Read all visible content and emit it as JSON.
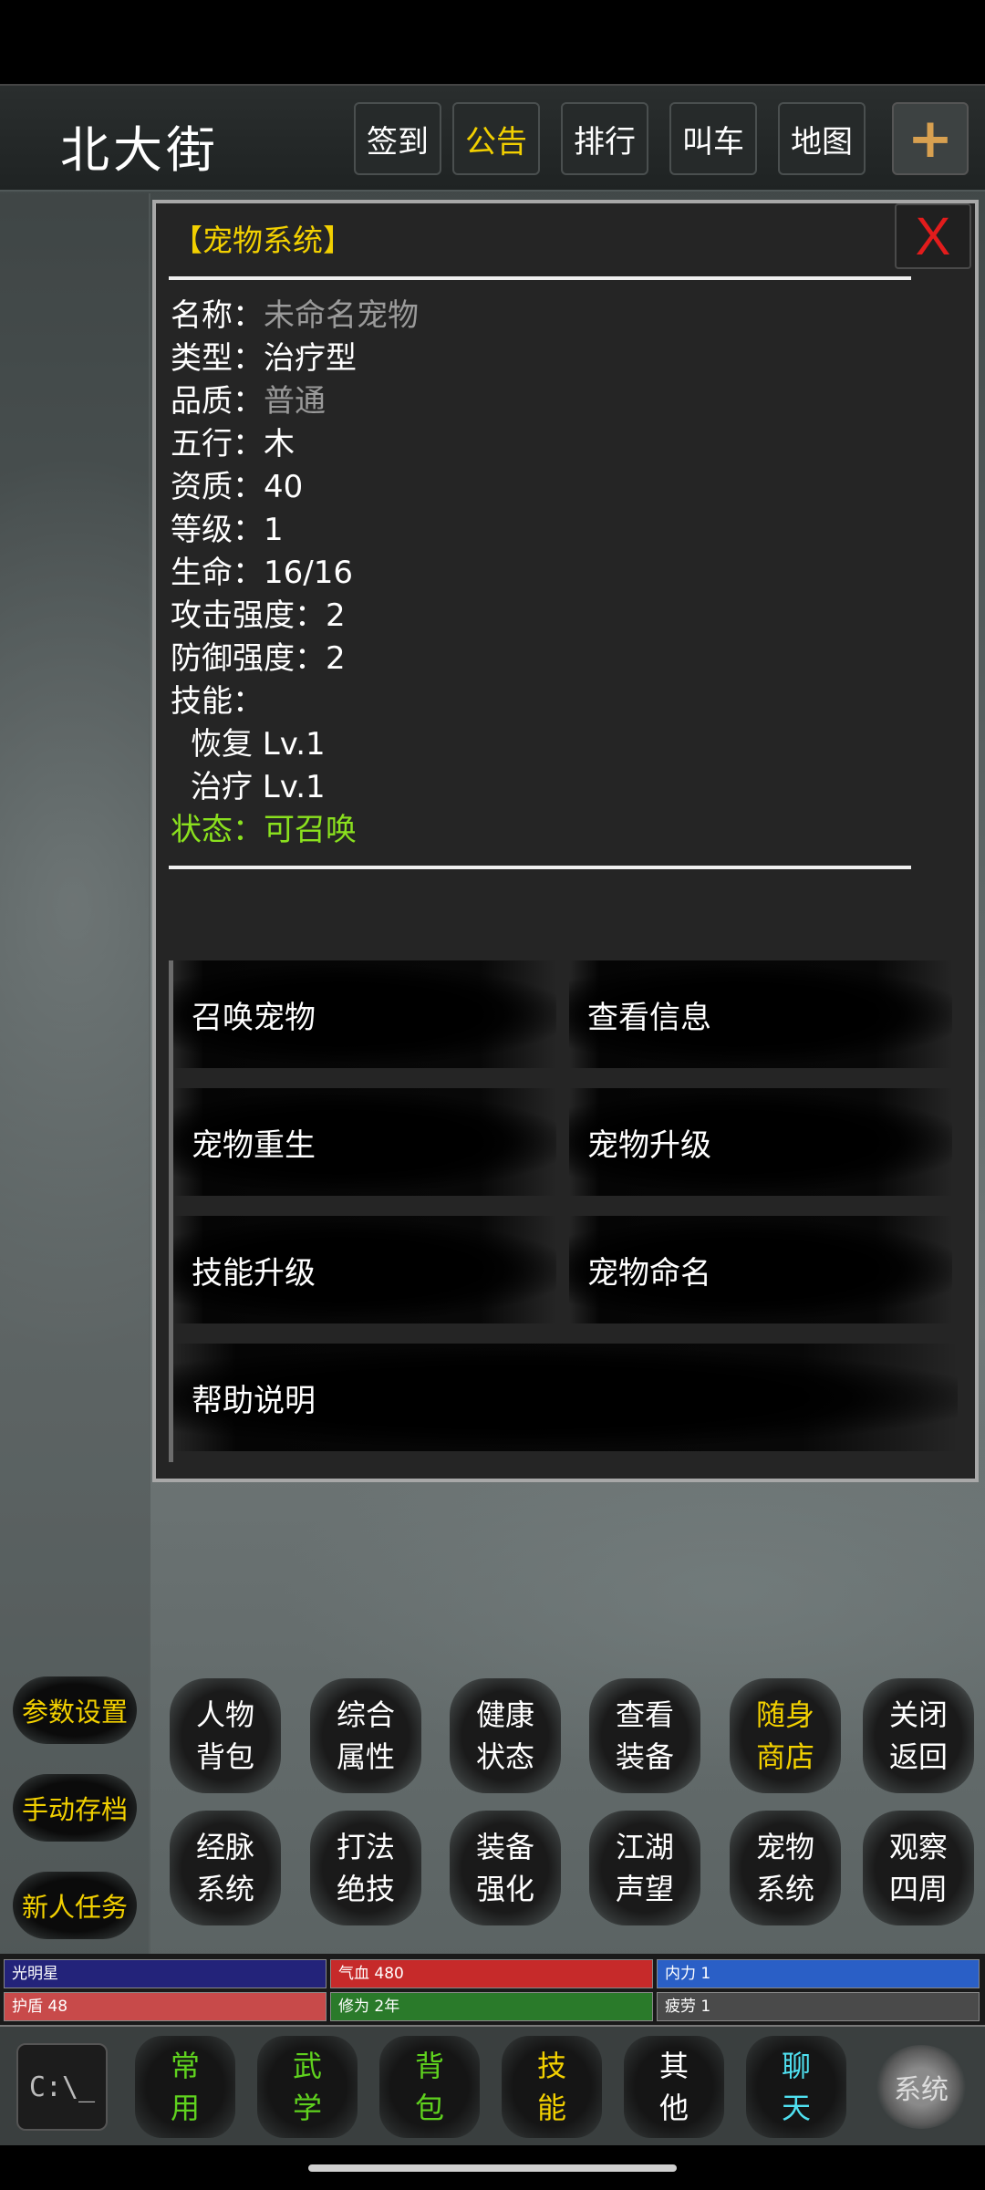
{
  "header": {
    "location": "北大街",
    "buttons": [
      "签到",
      "公告",
      "排行",
      "叫车",
      "地图"
    ],
    "plus": "+"
  },
  "panel": {
    "title": "【宠物系统】",
    "close": "X",
    "fields": [
      {
        "label": "名称：",
        "value": "未命名宠物",
        "gray": true
      },
      {
        "label": "类型：",
        "value": "治疗型"
      },
      {
        "label": "品质：",
        "value": "普通",
        "gray": true
      },
      {
        "label": "五行：",
        "value": "木"
      },
      {
        "label": "资质：",
        "value": "40"
      },
      {
        "label": "等级：",
        "value": "1"
      },
      {
        "label": "生命：",
        "value": "16/16"
      },
      {
        "label": "攻击强度：",
        "value": "2"
      },
      {
        "label": "防御强度：",
        "value": "2"
      },
      {
        "label": "技能：",
        "value": ""
      }
    ],
    "skills": [
      "恢复 Lv.1",
      "治疗 Lv.1"
    ],
    "status": "状态：可召唤",
    "actions": [
      "召唤宠物",
      "查看信息",
      "宠物重生",
      "宠物升级",
      "技能升级",
      "宠物命名",
      "帮助说明"
    ]
  },
  "side_buttons": [
    "参数设置",
    "手动存档",
    "新人任务"
  ],
  "functions": [
    [
      "人物",
      "背包"
    ],
    [
      "综合",
      "属性"
    ],
    [
      "健康",
      "状态"
    ],
    [
      "查看",
      "装备"
    ],
    [
      "随身",
      "商店"
    ],
    [
      "关闭",
      "返回"
    ],
    [
      "经脉",
      "系统"
    ],
    [
      "打法",
      "绝技"
    ],
    [
      "装备",
      "强化"
    ],
    [
      "江湖",
      "声望"
    ],
    [
      "宠物",
      "系统"
    ],
    [
      "观察",
      "四周"
    ]
  ],
  "stats": [
    {
      "text": "光明星",
      "color": "#23237a",
      "fill": 1.0
    },
    {
      "text": "气血 480",
      "color": "#c62a2a",
      "fill": 1.0
    },
    {
      "text": "内力 1",
      "color": "#2a5fc6",
      "fill": 1.0
    },
    {
      "text": "护盾 48",
      "color": "#c84a4a",
      "fill": 1.0
    },
    {
      "text": "修为 2年",
      "color": "#2a7a2a",
      "fill": 1.0
    },
    {
      "text": "疲劳 1",
      "color": "#4a4a4a",
      "fill": 1.0
    }
  ],
  "tabs": [
    {
      "top": "常",
      "bottom": "用",
      "color": "#5fd21e"
    },
    {
      "top": "武",
      "bottom": "学",
      "color": "#5fd21e"
    },
    {
      "top": "背",
      "bottom": "包",
      "color": "#5fd21e"
    },
    {
      "top": "技",
      "bottom": "能",
      "color": "#f2d000"
    },
    {
      "top": "其",
      "bottom": "他",
      "color": "#ffffff"
    },
    {
      "top": "聊",
      "bottom": "天",
      "color": "#4fe0f0"
    }
  ],
  "console_label": "C:\\_",
  "gear_label": "系统",
  "colors": {
    "gold": "#f2d000",
    "green": "#8ae01e",
    "close_red": "#e21c1c"
  }
}
